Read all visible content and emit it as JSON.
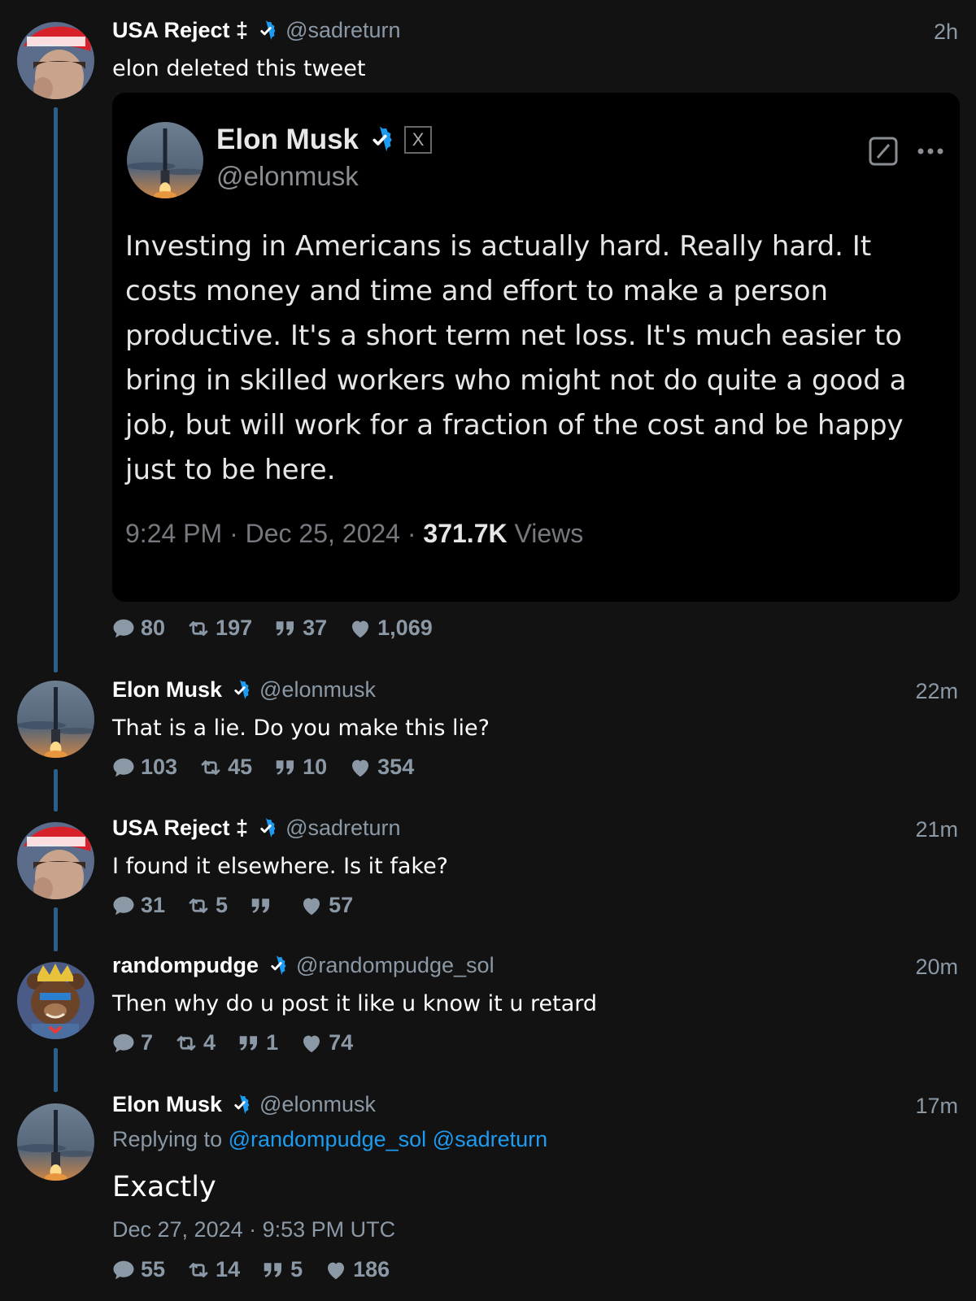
{
  "colors": {
    "background": "#121212",
    "accent": "#1d9bf0",
    "muted": "#8b98a5",
    "thread_line": "#2a5f8d"
  },
  "tweets": [
    {
      "name": "USA Reject ‡",
      "handle": "@sadreturn",
      "time": "2h",
      "text": "elon deleted this tweet",
      "embed": {
        "name": "Elon Musk",
        "handle": "@elonmusk",
        "x_label": "X",
        "body": "Investing in Americans is actually hard. Really hard. It costs money and time and effort to make a person productive. It's a short term net loss. It's much easier to bring in skilled workers who might not do quite a good a job, but will work for a fraction of the cost and be happy just to be here.",
        "meta": "9:24 PM · Dec 25, 2024 · ",
        "views_count": "371.7K",
        "views_label": " Views"
      },
      "stats": {
        "replies": "80",
        "retweets": "197",
        "quotes": "37",
        "likes": "1,069"
      }
    },
    {
      "name": "Elon Musk",
      "handle": "@elonmusk",
      "time": "22m",
      "text": "That is a lie. Do you make this lie?",
      "stats": {
        "replies": "103",
        "retweets": "45",
        "quotes": "10",
        "likes": "354"
      }
    },
    {
      "name": "USA Reject ‡",
      "handle": "@sadreturn",
      "time": "21m",
      "text": "I found it elsewhere. Is it fake?",
      "stats": {
        "replies": "31",
        "retweets": "5",
        "quotes": "",
        "likes": "57"
      }
    },
    {
      "name": "randompudge",
      "handle": "@randompudge_sol",
      "time": "20m",
      "text": "Then why do u post it like u know it u retard",
      "stats": {
        "replies": "7",
        "retweets": "4",
        "quotes": "1",
        "likes": "74"
      }
    },
    {
      "name": "Elon Musk",
      "handle": "@elonmusk",
      "time": "17m",
      "replying_prefix": "Replying to ",
      "mention1": "@randompudge_sol",
      "mention2": " @sadreturn",
      "text": "Exactly",
      "date": "Dec 27, 2024 · 9:53 PM UTC",
      "stats": {
        "replies": "55",
        "retweets": "14",
        "quotes": "5",
        "likes": "186"
      }
    }
  ],
  "avatar_icons": [
    "maga-hat-avatar",
    "starship-avatar",
    "bear-king-avatar"
  ]
}
